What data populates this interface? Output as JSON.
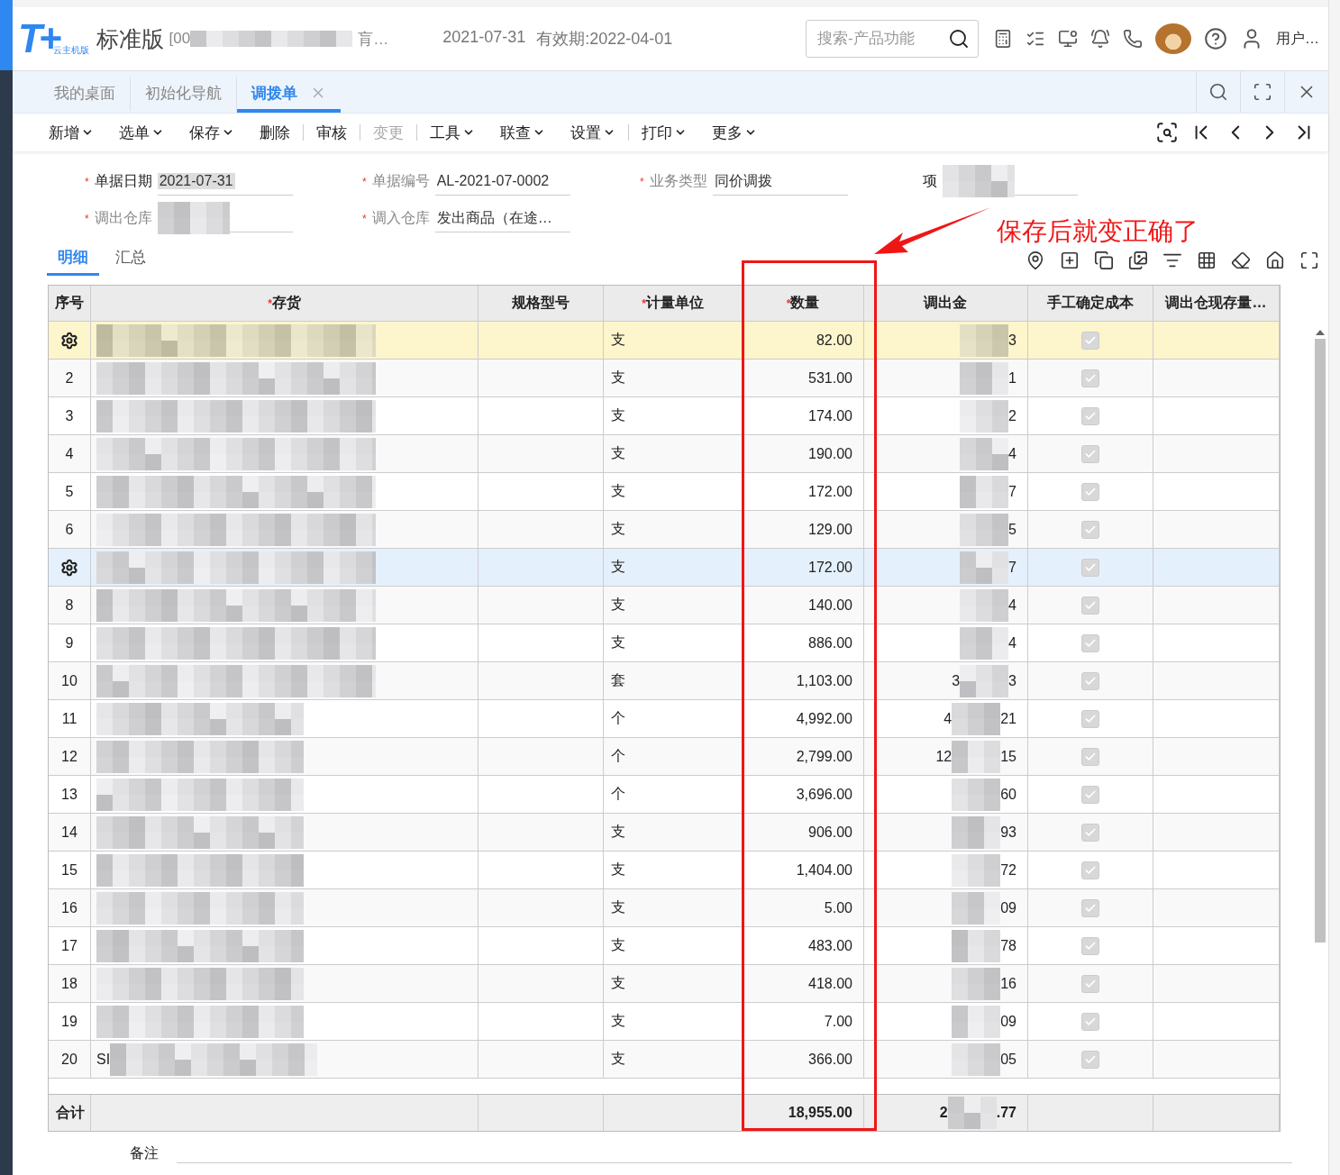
{
  "app": {
    "logo": "T+",
    "logo_sub": "云主机版",
    "edition": "标准版",
    "account_prefix": "[00",
    "account_suffix": "肓…",
    "date": "2021-07-31",
    "validity": "有效期:2022-04-01",
    "search": {
      "placeholder": "搜索-产品功能"
    },
    "user": "用户…"
  },
  "tabs": [
    {
      "label": "我的桌面",
      "selected": false,
      "closable": false
    },
    {
      "label": "初始化导航",
      "selected": false,
      "closable": false
    },
    {
      "label": "调拨单",
      "selected": true,
      "closable": true
    }
  ],
  "toolbar": [
    {
      "label": "新增",
      "dropdown": true,
      "divider": false,
      "disabled": false
    },
    {
      "label": "选单",
      "dropdown": true,
      "divider": false,
      "disabled": false
    },
    {
      "label": "保存",
      "dropdown": true,
      "divider": false,
      "disabled": false
    },
    {
      "label": "删除",
      "dropdown": false,
      "divider": false,
      "disabled": false
    },
    {
      "label": "审核",
      "dropdown": false,
      "divider": true,
      "disabled": false
    },
    {
      "label": "变更",
      "dropdown": false,
      "divider": true,
      "disabled": true
    },
    {
      "label": "工具",
      "dropdown": true,
      "divider": true,
      "disabled": false
    },
    {
      "label": "联查",
      "dropdown": true,
      "divider": false,
      "disabled": false
    },
    {
      "label": "设置",
      "dropdown": true,
      "divider": false,
      "disabled": false
    },
    {
      "label": "打印",
      "dropdown": true,
      "divider": true,
      "disabled": false
    },
    {
      "label": "更多",
      "dropdown": true,
      "divider": false,
      "disabled": false
    }
  ],
  "form": {
    "fields": [
      {
        "mark": "*",
        "label": "单据日期",
        "value": "2021-07-31",
        "readonly": false,
        "highlighted": true
      },
      {
        "mark": "*",
        "label": "单据编号",
        "value": "AL-2021-07-0002",
        "readonly": true,
        "highlighted": false
      },
      {
        "mark": "*",
        "label": "业务类型",
        "value": "同价调拨",
        "readonly": true,
        "highlighted": false
      },
      {
        "label": "项",
        "readonly": false
      },
      {
        "mark": "*",
        "label": "调出仓库",
        "readonly": true
      },
      {
        "mark": "*",
        "label": "调入仓库",
        "value": "发出商品（在途…",
        "readonly": true,
        "highlighted": false
      }
    ]
  },
  "subtabs": [
    {
      "label": "明细",
      "selected": true
    },
    {
      "label": "汇总",
      "selected": false
    }
  ],
  "annotation": {
    "text": "保存后就变正确了"
  },
  "table": {
    "columns": [
      {
        "label": "序号"
      },
      {
        "mark": "*",
        "label": "存货"
      },
      {
        "label": "规格型号"
      },
      {
        "mark": "*",
        "label": "计量单位"
      },
      {
        "mark": "*",
        "label": "数量"
      },
      {
        "label": "调出金"
      },
      {
        "label": "手工确定成本"
      },
      {
        "label": "调出仓现存量…"
      }
    ],
    "rows": [
      {
        "marker": true,
        "selected": true,
        "hovered": false,
        "unit": "支",
        "quantity": "82.00",
        "amount_tail": "3",
        "manual_cost": true
      },
      {
        "seq": "2",
        "selected": false,
        "hovered": false,
        "unit": "支",
        "quantity": "531.00",
        "amount_tail": "1",
        "manual_cost": true
      },
      {
        "seq": "3",
        "selected": false,
        "hovered": false,
        "unit": "支",
        "quantity": "174.00",
        "amount_tail": "2",
        "manual_cost": true
      },
      {
        "seq": "4",
        "selected": false,
        "hovered": false,
        "unit": "支",
        "quantity": "190.00",
        "amount_tail": "4",
        "manual_cost": true
      },
      {
        "seq": "5",
        "selected": false,
        "hovered": false,
        "unit": "支",
        "quantity": "172.00",
        "amount_tail": "7",
        "manual_cost": true
      },
      {
        "seq": "6",
        "selected": false,
        "hovered": false,
        "unit": "支",
        "quantity": "129.00",
        "amount_tail": "5",
        "manual_cost": true
      },
      {
        "marker": true,
        "selected": false,
        "hovered": true,
        "unit": "支",
        "quantity": "172.00",
        "amount_tail": "7",
        "manual_cost": true
      },
      {
        "seq": "8",
        "selected": false,
        "hovered": false,
        "unit": "支",
        "quantity": "140.00",
        "amount_tail": "4",
        "manual_cost": true
      },
      {
        "seq": "9",
        "selected": false,
        "hovered": false,
        "unit": "支",
        "quantity": "886.00",
        "amount_tail": "4",
        "manual_cost": true
      },
      {
        "seq": "10",
        "selected": false,
        "hovered": false,
        "unit": "套",
        "quantity": "1,103.00",
        "amount_head": "3",
        "amount_tail": "3",
        "manual_cost": true
      },
      {
        "seq": "11",
        "selected": false,
        "hovered": false,
        "unit": "个",
        "quantity": "4,992.00",
        "amount_head": "4",
        "amount_tail": "21",
        "manual_cost": true
      },
      {
        "seq": "12",
        "selected": false,
        "hovered": false,
        "unit": "个",
        "quantity": "2,799.00",
        "amount_head": "12",
        "amount_tail": "15",
        "manual_cost": true
      },
      {
        "seq": "13",
        "selected": false,
        "hovered": false,
        "unit": "个",
        "quantity": "3,696.00",
        "amount_tail": "60",
        "manual_cost": true
      },
      {
        "seq": "14",
        "selected": false,
        "hovered": false,
        "unit": "支",
        "quantity": "906.00",
        "amount_tail": "93",
        "manual_cost": true
      },
      {
        "seq": "15",
        "selected": false,
        "hovered": false,
        "unit": "支",
        "quantity": "1,404.00",
        "amount_tail": "72",
        "manual_cost": true
      },
      {
        "seq": "16",
        "selected": false,
        "hovered": false,
        "unit": "支",
        "quantity": "5.00",
        "amount_tail": "09",
        "manual_cost": true
      },
      {
        "seq": "17",
        "selected": false,
        "hovered": false,
        "unit": "支",
        "quantity": "483.00",
        "amount_tail": "78",
        "manual_cost": true
      },
      {
        "seq": "18",
        "selected": false,
        "hovered": false,
        "unit": "支",
        "quantity": "418.00",
        "amount_tail": "16",
        "manual_cost": true
      },
      {
        "seq": "19",
        "selected": false,
        "hovered": false,
        "unit": "支",
        "quantity": "7.00",
        "amount_tail": "09",
        "manual_cost": true
      },
      {
        "seq": "20",
        "product_prefix": "SI",
        "selected": false,
        "hovered": false,
        "unit": "支",
        "quantity": "366.00",
        "amount_tail": "05",
        "manual_cost": true
      }
    ],
    "totals": {
      "label": "合计",
      "quantity": "18,955.00",
      "amount_head": "2",
      "amount_tail": ".77"
    }
  },
  "remarks": {
    "label": "备注"
  }
}
